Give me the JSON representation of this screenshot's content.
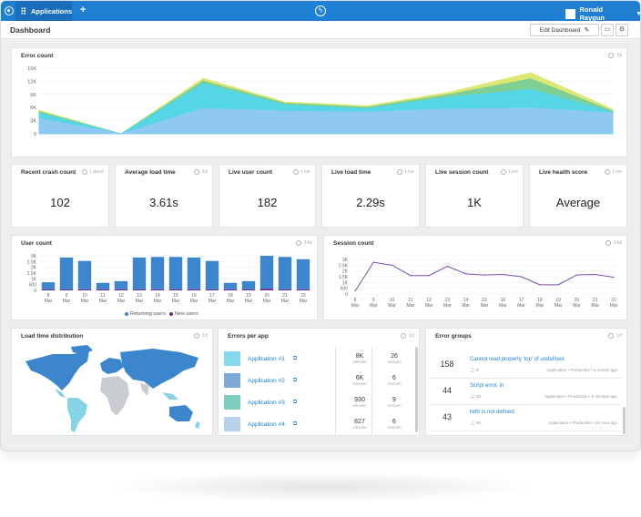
{
  "topbar": {
    "apps_label": "Applications",
    "user_name": "Ronald Raygun"
  },
  "header": {
    "title": "Dashboard",
    "edit_label": "Edit Dashboard"
  },
  "error_count": {
    "title": "Error count",
    "tag": "7d",
    "chart_data": {
      "type": "area",
      "title": "Error count",
      "x_points": 8,
      "ylim": [
        0,
        15000
      ],
      "y_ticks": [
        "15K",
        "12K",
        "9K",
        "6K",
        "3K",
        "0"
      ],
      "series": [
        {
          "color": "#8ec9f2",
          "values": [
            3500,
            0,
            5800,
            5200,
            5000,
            5700,
            5900,
            4800
          ]
        },
        {
          "color": "#55d6e6",
          "values": [
            4800,
            0,
            11500,
            6600,
            5800,
            8400,
            10200,
            5000
          ]
        },
        {
          "color": "#7fcf94",
          "values": [
            5100,
            0,
            12100,
            7000,
            6100,
            9000,
            12600,
            5200
          ]
        },
        {
          "color": "#dde772",
          "values": [
            5400,
            0,
            12700,
            7300,
            6400,
            9500,
            14000,
            5600
          ]
        }
      ]
    }
  },
  "stats": [
    {
      "title": "Recent crash count",
      "tag": "Latest",
      "value": "102"
    },
    {
      "title": "Average load time",
      "tag": "1d",
      "value": "3.61s"
    },
    {
      "title": "Live user count",
      "tag": "Live",
      "value": "182"
    },
    {
      "title": "Live load time",
      "tag": "Live",
      "value": "2.29s"
    },
    {
      "title": "Live session count",
      "tag": "Live",
      "value": "1K"
    },
    {
      "title": "Live health score",
      "tag": "Live",
      "value": "Average"
    }
  ],
  "user_count": {
    "title": "User count",
    "tag": "14d",
    "legend": {
      "returning": "Returning users",
      "new": "New users"
    },
    "colors": {
      "returning": "#3b86cc",
      "new": "#6a2c91"
    },
    "chart_data": {
      "type": "bar",
      "title": "User count",
      "categories": [
        "8",
        "9",
        "10",
        "11",
        "12",
        "13",
        "14",
        "15",
        "16",
        "17",
        "18",
        "19",
        "20",
        "21",
        "22"
      ],
      "x_tick_labels": [
        "8 Mar",
        "9 Mar",
        "10 Mar",
        "11 Mar",
        "12 Mar",
        "13 Mar",
        "14 Mar",
        "15 Mar",
        "16 Mar",
        "17 Mar",
        "18 Mar",
        "19 Mar",
        "20 Mar",
        "21 Mar",
        "22 Mar"
      ],
      "ylim": [
        0,
        3000
      ],
      "y_ticks": [
        "3K",
        "2.5K",
        "2K",
        "1.5K",
        "1K",
        "500",
        "0"
      ],
      "series": [
        {
          "name": "Returning users",
          "values": [
            600,
            2750,
            2450,
            550,
            700,
            2750,
            2800,
            2800,
            2750,
            2450,
            550,
            700,
            2850,
            2800,
            2600
          ]
        },
        {
          "name": "New users",
          "values": [
            100,
            100,
            100,
            100,
            100,
            100,
            100,
            100,
            100,
            100,
            100,
            100,
            150,
            100,
            100
          ]
        }
      ]
    }
  },
  "session_count": {
    "title": "Session count",
    "tag": "14d",
    "chart_data": {
      "type": "line",
      "title": "Session count",
      "categories": [
        "8",
        "9",
        "10",
        "11",
        "12",
        "13",
        "14",
        "15",
        "16",
        "17",
        "18",
        "19",
        "20",
        "21",
        "22"
      ],
      "x_tick_labels": [
        "8 Mar",
        "9 Mar",
        "10 Mar",
        "11 Mar",
        "12 Mar",
        "13 Mar",
        "14 Mar",
        "15 Mar",
        "16 Mar",
        "17 Mar",
        "18 Mar",
        "19 Mar",
        "20 Mar",
        "21 Mar",
        "22 Mar"
      ],
      "ylim": [
        0,
        3000
      ],
      "y_ticks": [
        "3K",
        "2.5K",
        "2K",
        "1.5K",
        "1K",
        "500",
        "0"
      ],
      "color": "#7b4fa8",
      "values": [
        250,
        2750,
        2500,
        1600,
        1600,
        2400,
        1750,
        1650,
        1700,
        1500,
        800,
        800,
        1650,
        1700,
        1450
      ]
    }
  },
  "load_time": {
    "title": "Load time distribution",
    "tag": "1d",
    "colors": {
      "high": "#3b86cc",
      "mid": "#86d3e8",
      "low": "#c9cdd1"
    }
  },
  "errors_per_app": {
    "title": "Errors per app",
    "tag": "1d",
    "errors_label": "ERRORS",
    "groups_label": "GROUPS",
    "apps": [
      {
        "name": "Application #1",
        "errors": "8K",
        "groups": "26",
        "color": "#86d9ec"
      },
      {
        "name": "Application #2",
        "errors": "6K",
        "groups": "6",
        "color": "#7fa9d6"
      },
      {
        "name": "Application #3",
        "errors": "930",
        "groups": "9",
        "color": "#7ecfc0"
      },
      {
        "name": "Application #4",
        "errors": "827",
        "groups": "6",
        "color": "#b9d2ea"
      }
    ]
  },
  "error_groups": {
    "title": "Error groups",
    "tag": "1d",
    "items": [
      {
        "count": "158",
        "message": "Cannot read property 'top' of undefined",
        "users": "8",
        "context": "Application",
        "env": "Production",
        "time": "a minute ago"
      },
      {
        "count": "44",
        "message": "Script error. in",
        "users": "33",
        "context": "Application",
        "env": "Production",
        "time": "5 minutes ago"
      },
      {
        "count": "43",
        "message": "twttr is not defined",
        "users": "90",
        "context": "Application",
        "env": "Production",
        "time": "an hour ago"
      }
    ]
  }
}
